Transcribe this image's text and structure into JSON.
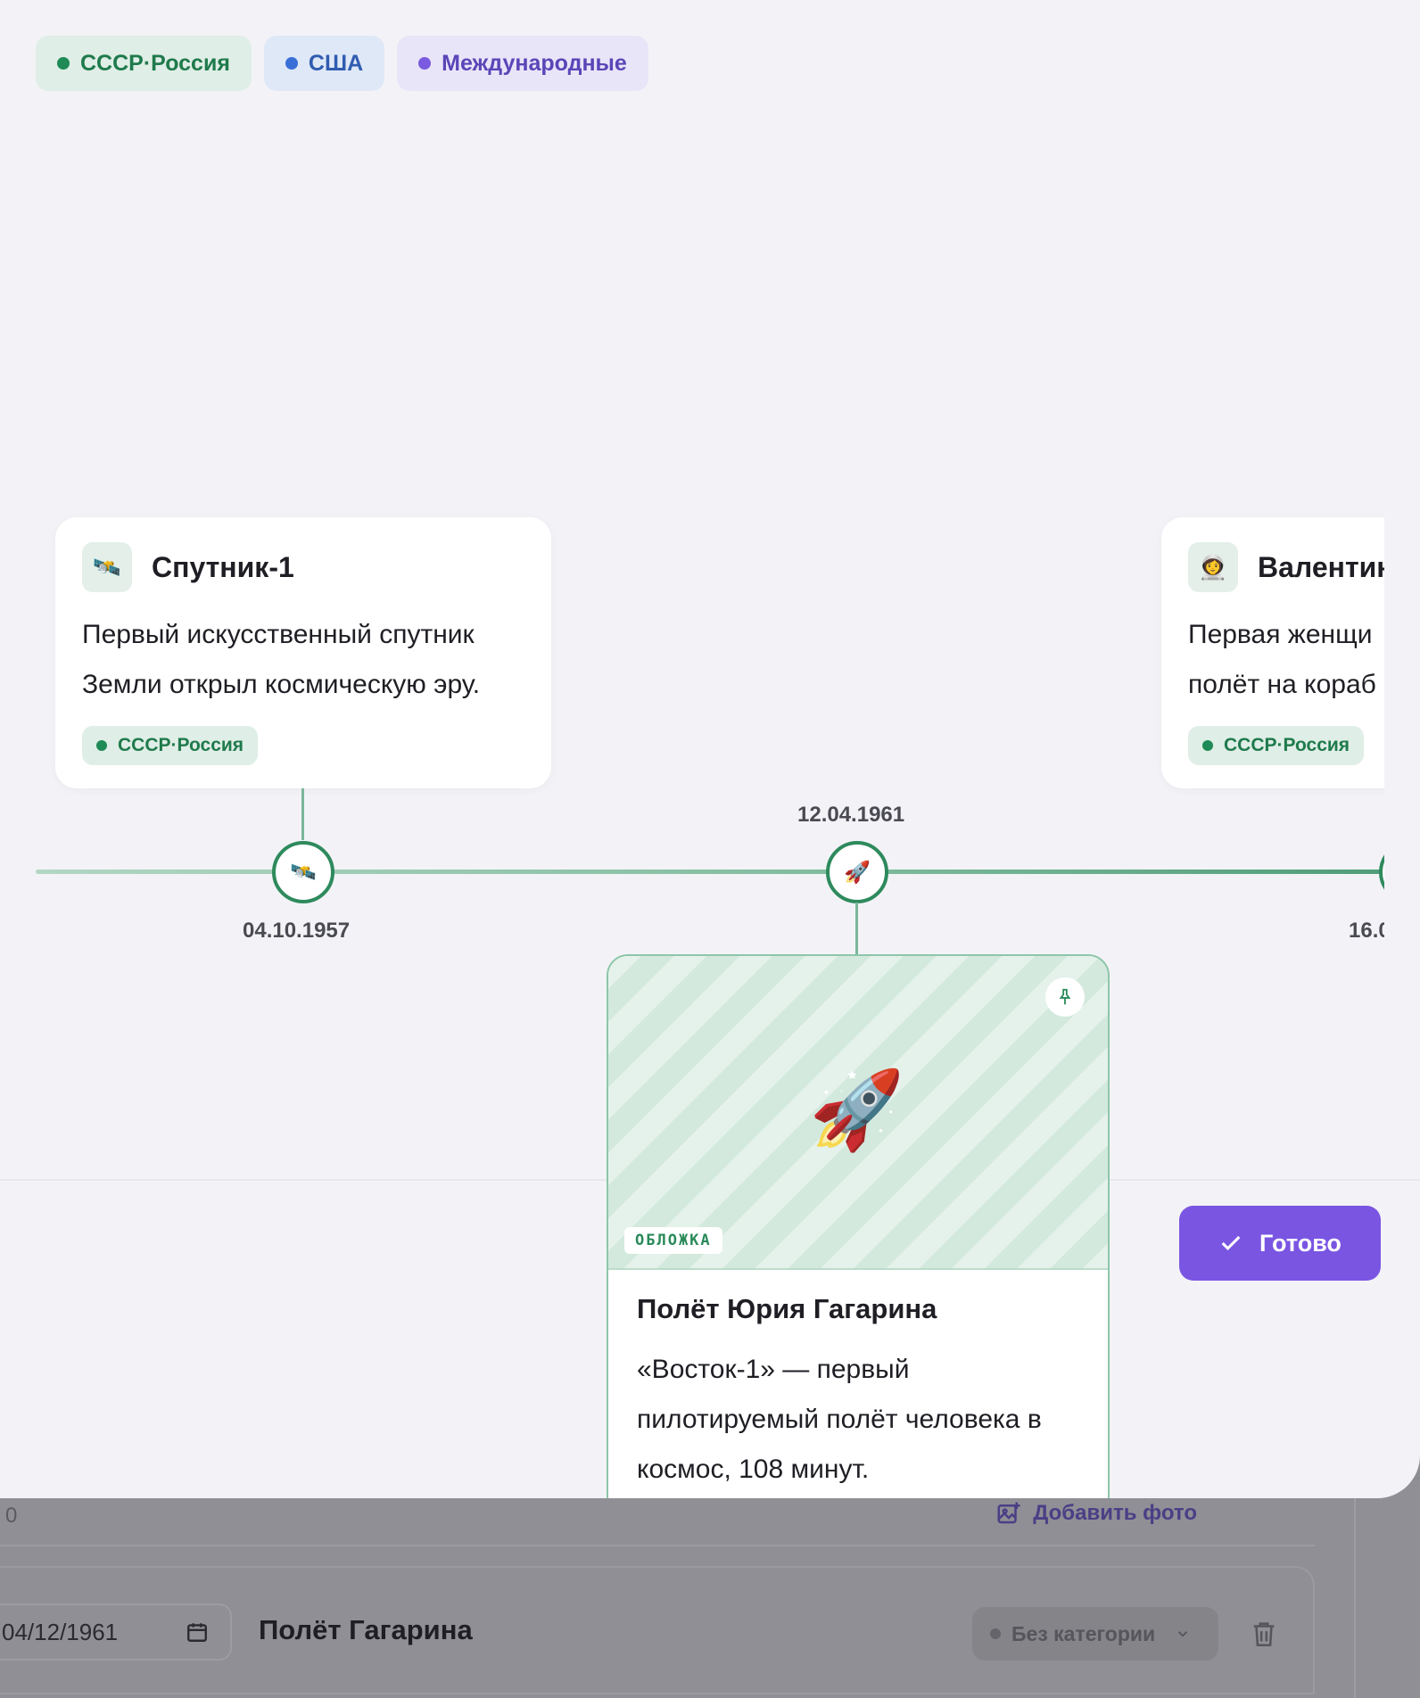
{
  "legend": [
    {
      "label": "СССР·Россия",
      "color": "#1f8a55"
    },
    {
      "label": "США",
      "color": "#3a6fd8"
    },
    {
      "label": "Международные",
      "color": "#7a5ae0"
    }
  ],
  "timeline": {
    "events": [
      {
        "date": "04.10.1957",
        "icon": "🛰️",
        "title": "Спутник-1",
        "description_lines": [
          "Первый искусственный спутник",
          "Земли открыл космическую эру."
        ],
        "tag": "СССР·Россия"
      },
      {
        "date": "12.04.1961",
        "icon": "🚀",
        "title": "Полёт Юрия Гагарина",
        "description_lines": [
          "«Восток-1» — первый",
          "пилотируемый полёт человека в",
          "космос, 108 минут."
        ],
        "cover_badge": "ОБЛОЖКА"
      },
      {
        "date": "16.0",
        "icon": "👩‍🚀",
        "title": "Валентин",
        "description_lines": [
          "Первая женщи",
          "полёт на кораб"
        ],
        "tag": "СССР·Россия"
      }
    ]
  },
  "actions": {
    "done_label": "Готово"
  },
  "background_editor": {
    "row1_text": "0",
    "add_photo_label": "Добавить фото",
    "date_value": "04/12/1961",
    "event_title": "Полёт Гагарина",
    "category_label": "Без категории"
  },
  "colors": {
    "accent": "#7a55e2",
    "timeline_green": "#2e8a5d"
  }
}
